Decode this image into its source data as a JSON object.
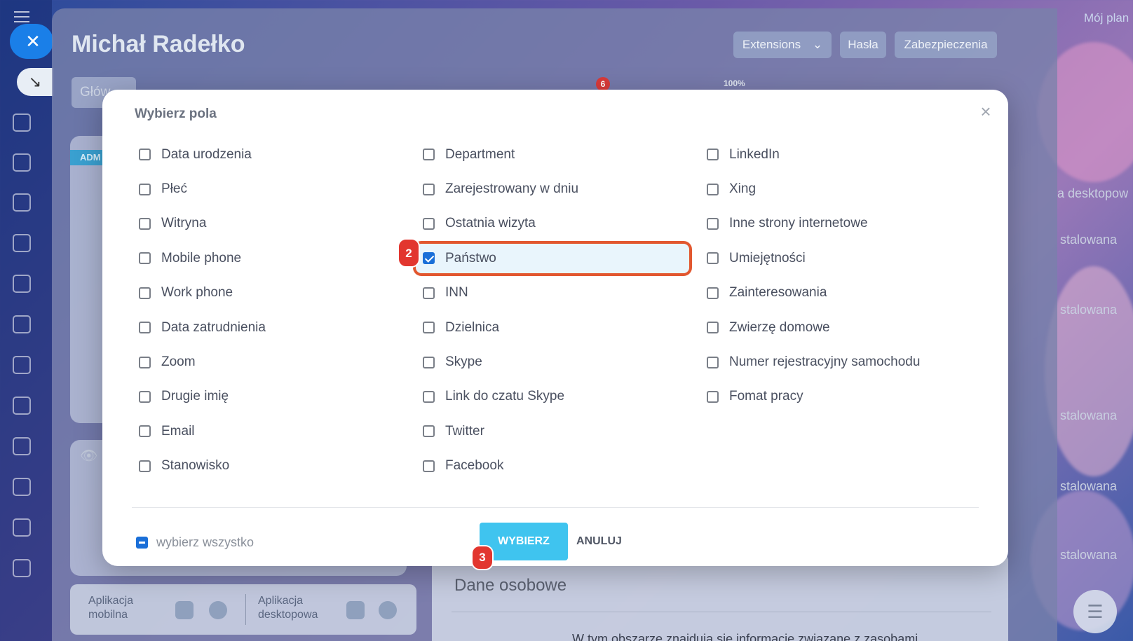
{
  "background": {
    "top_right_link": "Mój plan"
  },
  "profile": {
    "name": "Michał Radełko",
    "buttons": {
      "extensions": "Extensions",
      "passwords": "Hasła",
      "security": "Zabezpieczenia"
    },
    "first_tab": "Głów",
    "tab_badge": "6",
    "tab_percent": "100%",
    "admin_badge": "ADM",
    "apps": {
      "mobile": "Aplikacja mobilna",
      "desktop": "Aplikacja desktopowa"
    },
    "personal_data": {
      "title": "Dane osobowe",
      "text": "W tym obszarze znajdują się informacje związane z zasobami"
    },
    "right_fragments": [
      "a desktopow",
      "stalowana",
      "stalowana",
      "stalowana",
      "stalowana",
      "stalowana"
    ]
  },
  "modal": {
    "title": "Wybierz pola",
    "columns": [
      [
        {
          "label": "Data urodzenia",
          "checked": false
        },
        {
          "label": "Płeć",
          "checked": false
        },
        {
          "label": "Witryna",
          "checked": false
        },
        {
          "label": "Mobile phone",
          "checked": false
        },
        {
          "label": "Work phone",
          "checked": false
        },
        {
          "label": "Data zatrudnienia",
          "checked": false
        },
        {
          "label": "Zoom",
          "checked": false
        },
        {
          "label": "Drugie imię",
          "checked": false
        },
        {
          "label": "Email",
          "checked": false
        },
        {
          "label": "Stanowisko",
          "checked": false
        }
      ],
      [
        {
          "label": "Department",
          "checked": false
        },
        {
          "label": "Zarejestrowany w dniu",
          "checked": false
        },
        {
          "label": "Ostatnia wizyta",
          "checked": false
        },
        {
          "label": "Państwo",
          "checked": true
        },
        {
          "label": "INN",
          "checked": false
        },
        {
          "label": "Dzielnica",
          "checked": false
        },
        {
          "label": "Skype",
          "checked": false
        },
        {
          "label": "Link do czatu Skype",
          "checked": false
        },
        {
          "label": "Twitter",
          "checked": false
        },
        {
          "label": "Facebook",
          "checked": false
        }
      ],
      [
        {
          "label": "LinkedIn",
          "checked": false
        },
        {
          "label": "Xing",
          "checked": false
        },
        {
          "label": "Inne strony internetowe",
          "checked": false
        },
        {
          "label": "Umiejętności",
          "checked": false
        },
        {
          "label": "Zainteresowania",
          "checked": false
        },
        {
          "label": "Zwierzę domowe",
          "checked": false
        },
        {
          "label": "Numer rejestracyjny samochodu",
          "checked": false
        },
        {
          "label": "Fomat pracy",
          "checked": false
        }
      ]
    ],
    "select_all_label": "wybierz wszystko",
    "select_button": "WYBIERZ",
    "cancel_button": "ANULUJ",
    "step_badges": {
      "checkbox_step": "2",
      "button_step": "3"
    }
  },
  "colors": {
    "accent_blue": "#3fc4ef",
    "checkbox_blue": "#1a6fd8",
    "highlight_border": "#e2572f",
    "step_badge_red": "#e2362f"
  }
}
